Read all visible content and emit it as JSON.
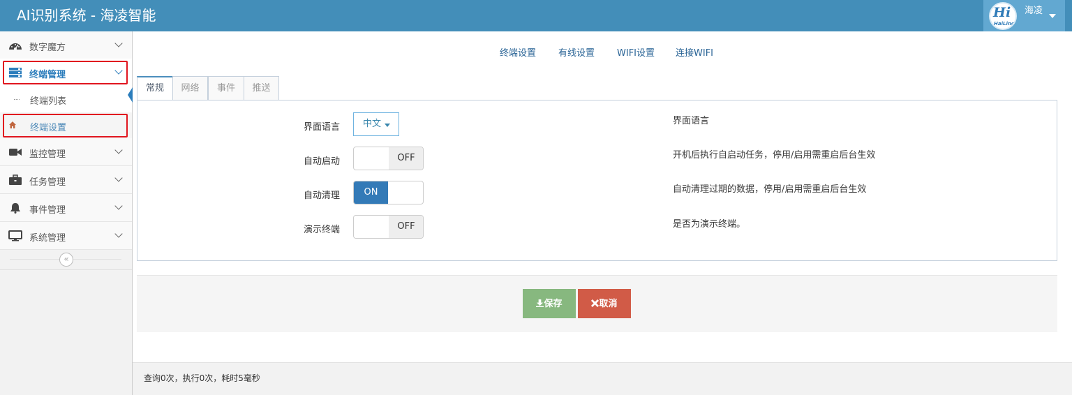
{
  "app": {
    "title": "AI识别系统 - 海凌智能"
  },
  "user": {
    "name": "海凌",
    "logo_text": "Hi",
    "logo_sub": "HaiLinc"
  },
  "sidebar": {
    "items": [
      {
        "label": "数字魔方",
        "icon": "dashboard-icon"
      },
      {
        "label": "终端管理",
        "icon": "server-icon"
      },
      {
        "label": "监控管理",
        "icon": "video-camera-icon"
      },
      {
        "label": "任务管理",
        "icon": "briefcase-icon"
      },
      {
        "label": "事件管理",
        "icon": "bell-icon"
      },
      {
        "label": "系统管理",
        "icon": "monitor-icon"
      }
    ],
    "subitems": [
      {
        "label": "终端列表"
      },
      {
        "label": "终端设置"
      }
    ],
    "collapse_symbol": "«"
  },
  "top_links": [
    "终端设置",
    "有线设置",
    "WIFI设置",
    "连接WIFI"
  ],
  "tabs": [
    "常规",
    "网络",
    "事件",
    "推送"
  ],
  "form": {
    "language": {
      "label": "界面语言",
      "value": "中文",
      "help": "界面语言"
    },
    "auto_start": {
      "label": "自动启动",
      "state": "OFF",
      "help": "开机后执行自启动任务，停用/启用需重启后台生效"
    },
    "auto_clean": {
      "label": "自动清理",
      "state": "ON",
      "help": "自动清理过期的数据，停用/启用需重启后台生效"
    },
    "demo_terminal": {
      "label": "演示终端",
      "state": "OFF",
      "help": "是否为演示终端。"
    }
  },
  "buttons": {
    "save": "保存",
    "cancel": "取消"
  },
  "footer": {
    "text": "查询0次，执行0次，耗时5毫秒"
  },
  "colors": {
    "header": "#438eb9",
    "accent": "#2b7dbc",
    "save": "#87b87f",
    "cancel": "#d15b47",
    "highlight": "#e1161f"
  }
}
